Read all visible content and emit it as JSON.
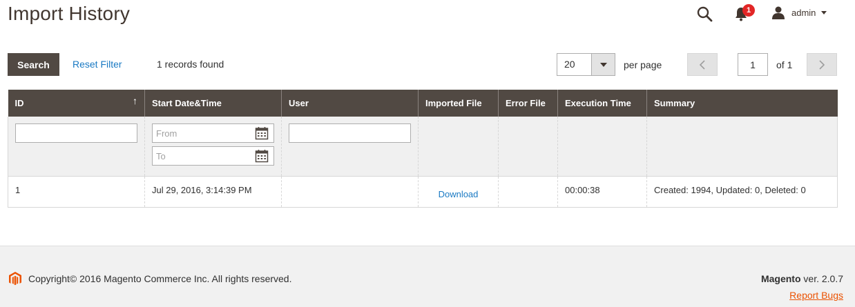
{
  "header": {
    "title": "Import History",
    "notifications_count": "1",
    "user_name": "admin"
  },
  "toolbar": {
    "search_label": "Search",
    "reset_filter_label": "Reset Filter",
    "records_found": "1 records found",
    "per_page_value": "20",
    "per_page_label": "per page",
    "current_page": "1",
    "of_pages": "of 1"
  },
  "grid": {
    "columns": [
      "ID",
      "Start Date&Time",
      "User",
      "Imported File",
      "Error File",
      "Execution Time",
      "Summary"
    ],
    "filters": {
      "date_from_placeholder": "From",
      "date_to_placeholder": "To"
    },
    "rows": [
      {
        "id": "1",
        "start_datetime": "Jul 29, 2016, 3:14:39 PM",
        "user": "",
        "imported_file": "Download",
        "error_file": "",
        "execution_time": "00:00:38",
        "summary": "Created: 1994, Updated: 0, Deleted: 0"
      }
    ]
  },
  "footer": {
    "copyright": "Copyright© 2016 Magento Commerce Inc. All rights reserved.",
    "brand": "Magento",
    "version": " ver. 2.0.7",
    "report_bugs": "Report Bugs"
  },
  "colors": {
    "header_bg": "#514943",
    "link": "#1979c3",
    "accent_orange": "#eb5202",
    "badge_red": "#e22626"
  },
  "icons": [
    "search-icon",
    "bell-icon",
    "user-icon",
    "chevron-down-icon",
    "chevron-left-icon",
    "chevron-right-icon",
    "calendar-icon",
    "sort-arrow-icon",
    "magento-logo-icon"
  ]
}
